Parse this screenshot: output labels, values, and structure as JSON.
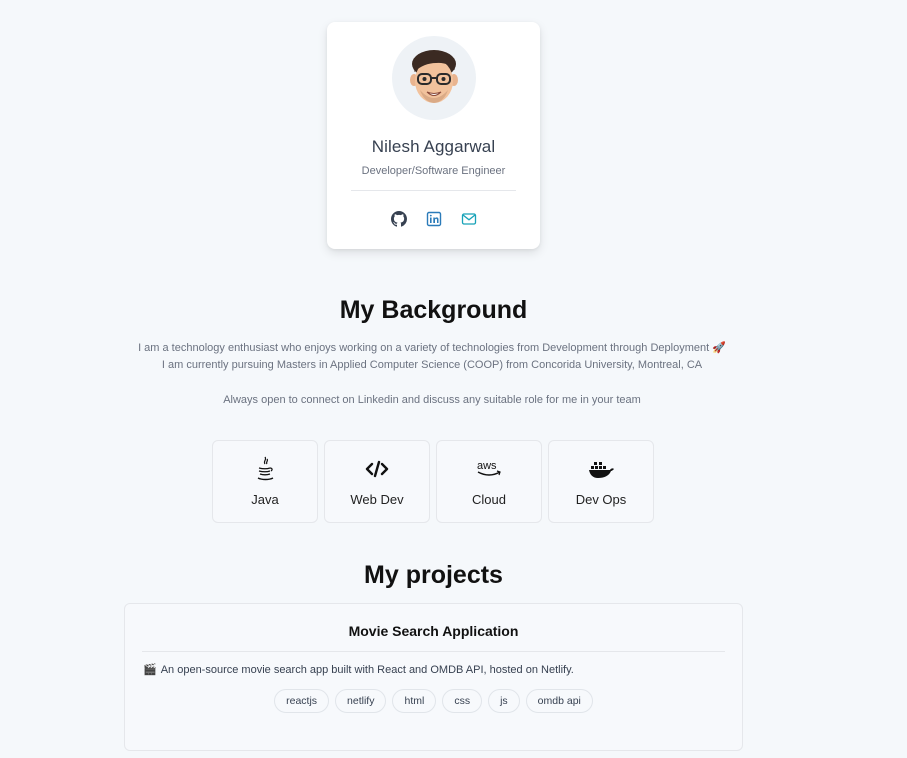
{
  "profile": {
    "name": "Nilesh Aggarwal",
    "role": "Developer/Software Engineer",
    "socials": [
      {
        "icon": "github-icon",
        "color": "#374151"
      },
      {
        "icon": "linkedin-icon",
        "color": "#2b7bb9"
      },
      {
        "icon": "mail-icon",
        "color": "#17a2b8"
      }
    ]
  },
  "background": {
    "title": "My Background",
    "line1": "I am a technology enthusiast who enjoys working on a variety of technologies from Development through Deployment 🚀",
    "line2": "I am currently pursuing Masters in Applied Computer Science (COOP) from Concorida University, Montreal, CA",
    "line3": "Always open to connect on Linkedin and discuss any suitable role for me in your team"
  },
  "skills": [
    {
      "label": "Java",
      "icon": "java-icon"
    },
    {
      "label": "Web Dev",
      "icon": "code-icon"
    },
    {
      "label": "Cloud",
      "icon": "aws-icon"
    },
    {
      "label": "Dev Ops",
      "icon": "docker-icon"
    }
  ],
  "projects": {
    "title": "My projects",
    "items": [
      {
        "name": "Movie Search Application",
        "description": "An open-source movie search app built with React and OMDB API, hosted on Netlify.",
        "description_icon": "clapperboard-icon",
        "tags": [
          "reactjs",
          "netlify",
          "html",
          "css",
          "js",
          "omdb api"
        ]
      }
    ]
  }
}
